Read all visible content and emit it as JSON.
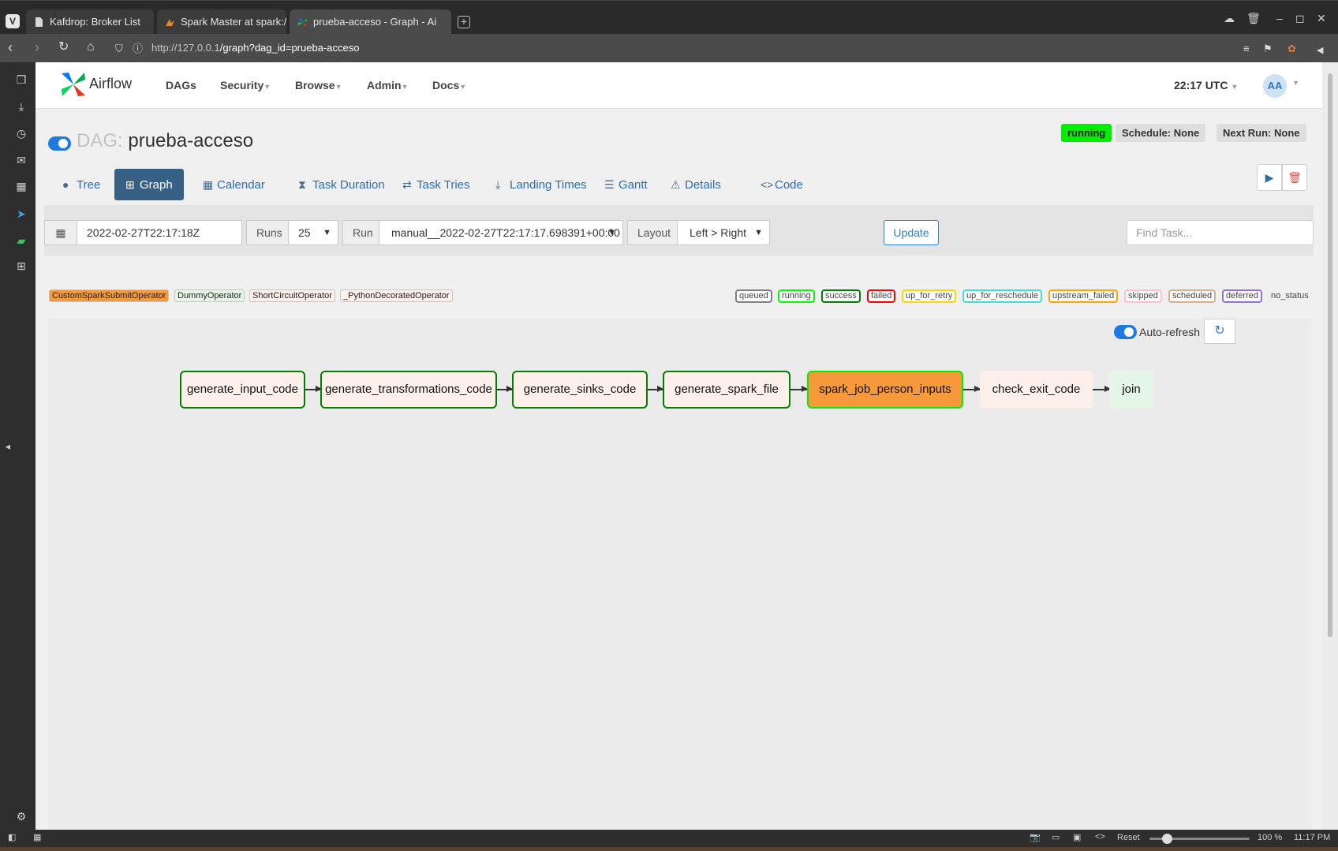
{
  "browser": {
    "tabs": [
      {
        "title": "Kafdrop: Broker List",
        "icon": "document-icon"
      },
      {
        "title": "Spark Master at spark://ce",
        "icon": "spark-icon"
      },
      {
        "title": "prueba-acceso - Graph - Ai",
        "icon": "airflow-icon"
      }
    ],
    "url_host": "http://127.0.0.1",
    "url_path": "/graph?dag_id=prueba-acceso",
    "status_reset": "Reset",
    "status_zoom": "100 %",
    "status_clock": "11:17 PM"
  },
  "header": {
    "brand": "Airflow",
    "menu": [
      {
        "label": "DAGs",
        "dropdown": false
      },
      {
        "label": "Security",
        "dropdown": true
      },
      {
        "label": "Browse",
        "dropdown": true
      },
      {
        "label": "Admin",
        "dropdown": true
      },
      {
        "label": "Docs",
        "dropdown": true
      }
    ],
    "clock": "22:17 UTC",
    "avatar_initials": "AA"
  },
  "dag": {
    "label": "DAG:",
    "name": "prueba-acceso",
    "state_badge": "running",
    "schedule_badge": "Schedule: None",
    "next_run_badge": "Next Run: None"
  },
  "view_tabs": [
    "Tree",
    "Graph",
    "Calendar",
    "Task Duration",
    "Task Tries",
    "Landing Times",
    "Gantt",
    "Details",
    "Code"
  ],
  "active_tab": "Graph",
  "filters": {
    "date": "2022-02-27T22:17:18Z",
    "runs_label": "Runs",
    "runs_value": "25",
    "run_label": "Run",
    "run_value": "manual__2022-02-27T22:17:17.698391+00:00",
    "layout_label": "Layout",
    "layout_value": "Left > Right",
    "update_label": "Update",
    "find_placeholder": "Find Task..."
  },
  "operators": [
    {
      "name": "CustomSparkSubmitOperator",
      "color": "#f6993b"
    },
    {
      "name": "DummyOperator",
      "color": "#e6f6e6"
    },
    {
      "name": "ShortCircuitOperator",
      "color": "#fdf0ea"
    },
    {
      "name": "_PythonDecoratedOperator",
      "color": "#fdf0ea"
    }
  ],
  "states": [
    {
      "name": "queued",
      "color": "#808080"
    },
    {
      "name": "running",
      "color": "#00ff00"
    },
    {
      "name": "success",
      "color": "#008000"
    },
    {
      "name": "failed",
      "color": "#ff0000"
    },
    {
      "name": "up_for_retry",
      "color": "#ffd700"
    },
    {
      "name": "up_for_reschedule",
      "color": "#40e0d0"
    },
    {
      "name": "upstream_failed",
      "color": "#ffa500"
    },
    {
      "name": "skipped",
      "color": "#ffc0cb"
    },
    {
      "name": "scheduled",
      "color": "#d2b48c"
    },
    {
      "name": "deferred",
      "color": "#9370db"
    },
    {
      "name": "no_status",
      "color": ""
    }
  ],
  "graph": {
    "autorefresh_label": "Auto-refresh",
    "tasks": [
      {
        "id": "generate_input_code",
        "state": "success"
      },
      {
        "id": "generate_transformations_code",
        "state": "success"
      },
      {
        "id": "generate_sinks_code",
        "state": "success"
      },
      {
        "id": "generate_spark_file",
        "state": "success"
      },
      {
        "id": "spark_job_person_inputs",
        "state": "running"
      },
      {
        "id": "check_exit_code",
        "state": "no_status"
      },
      {
        "id": "join",
        "state": "no_status"
      }
    ]
  }
}
